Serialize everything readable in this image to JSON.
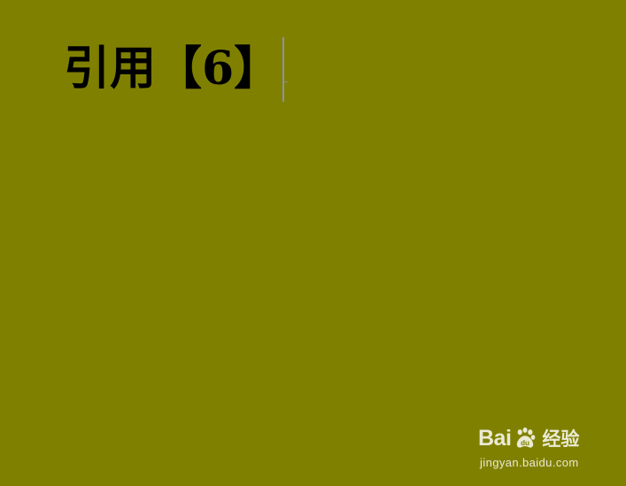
{
  "document": {
    "heading": "引用【6】"
  },
  "watermark": {
    "brand_left": "Bai",
    "brand_right": "du",
    "product": "经验",
    "url": "jingyan.baidu.com",
    "icon": "baidu-paw-icon"
  },
  "colors": {
    "background": "#808000",
    "text": "#000000",
    "caret": "#8d8fa7",
    "watermark": "#f3f3e8"
  }
}
